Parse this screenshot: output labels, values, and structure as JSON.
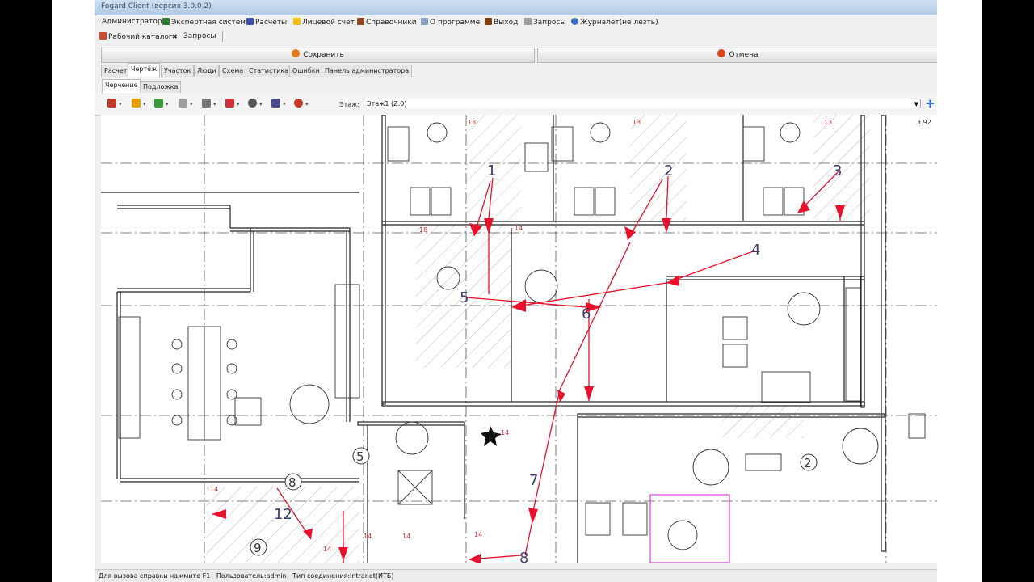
{
  "window": {
    "title": "Fogard Client (версия 3.0.0.2)"
  },
  "menu": {
    "items": [
      {
        "label": "Администратор",
        "color": "#000000"
      },
      {
        "label": "Экспертная система",
        "color": "#2e7d32"
      },
      {
        "label": "Расчеты",
        "color": "#3f51b5"
      },
      {
        "label": "Лицевой счет",
        "color": "#f2c200"
      },
      {
        "label": "Справочники",
        "color": "#8d4a1f"
      },
      {
        "label": "О программе",
        "color": "#8aa4c8"
      },
      {
        "label": "Выход",
        "color": "#7b3f12"
      },
      {
        "label": "Запросы",
        "color": "#9e9e9e"
      },
      {
        "label": "Журналёт(не лезть)",
        "color": "#3a6fc4"
      }
    ]
  },
  "doc_tabs": {
    "workdir": "Рабочий каталог",
    "close": "✖",
    "queries": "Запросы"
  },
  "actions": {
    "save": "Сохранить",
    "cancel": "Отмена",
    "save_color": "#e07b18",
    "cancel_color": "#d9461a"
  },
  "main_tabs": [
    "Расчет",
    "Чертёж",
    "Участок",
    "Люди",
    "Схема",
    "Статистика",
    "Ошибки",
    "Панель администратора"
  ],
  "sub_tabs": [
    "Черчение",
    "Подложка"
  ],
  "toolbar": {
    "buttons": [
      {
        "icon": "table-icon",
        "color": "#c0392b"
      },
      {
        "icon": "pencil-icon",
        "color": "#e6a300"
      },
      {
        "icon": "layers-icon",
        "color": "#3c9a3c"
      },
      {
        "icon": "measure-icon",
        "color": "#9e9e9e"
      },
      {
        "icon": "document-icon",
        "color": "#777777"
      },
      {
        "icon": "image-icon",
        "color": "#d0313c"
      },
      {
        "icon": "zoom-icon",
        "color": "#555555"
      },
      {
        "icon": "save-icon",
        "color": "#4a4a8a"
      },
      {
        "icon": "search-icon",
        "color": "#c0392b"
      }
    ],
    "floor_label": "Этаж:",
    "floor_value": "Этаж1 (Z:0)",
    "add_icon": "+"
  },
  "drawing": {
    "route_labels": [
      "1",
      "2",
      "3",
      "4",
      "5",
      "6",
      "7",
      "8",
      "12"
    ],
    "room_markers": [
      "8",
      "5",
      "2",
      "9",
      "13",
      "1"
    ],
    "small_labels": [
      "13",
      "13",
      "13",
      "14",
      "18",
      "14",
      "14",
      "14",
      "14",
      "14",
      "14",
      "3.92"
    ],
    "arrow_color": "#e8102a"
  },
  "status": {
    "help": "Для вызова справки нажмите F1",
    "user": "Пользователь:admin",
    "connection": "Тип соединения:Intranet(ИТБ)"
  }
}
